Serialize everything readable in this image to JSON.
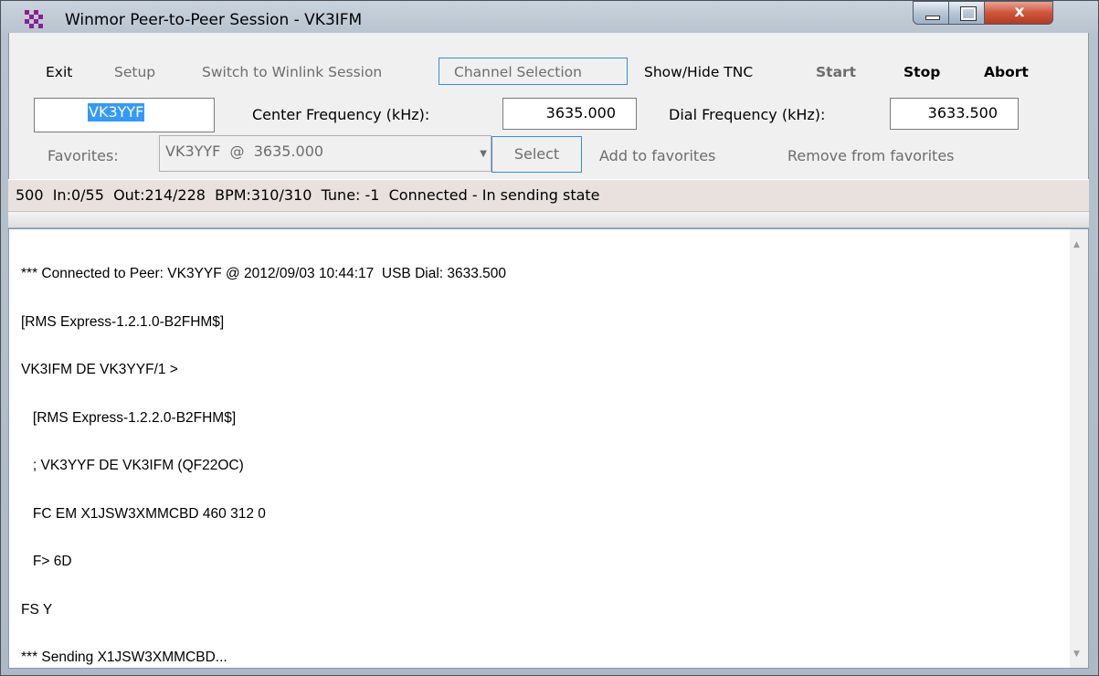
{
  "window": {
    "title": "Winmor Peer-to-Peer Session - VK3IFM",
    "close_glyph": "x"
  },
  "menu": [
    {
      "label": "Exit",
      "enabled": true,
      "bold": false
    },
    {
      "label": "Setup",
      "enabled": false,
      "bold": false
    },
    {
      "label": "Switch to Winlink Session",
      "enabled": false,
      "bold": false
    },
    {
      "label": "Channel Selection",
      "enabled": false,
      "bold": false
    },
    {
      "label": "Show/Hide TNC",
      "enabled": true,
      "bold": false
    },
    {
      "label": "Start",
      "enabled": false,
      "bold": true
    },
    {
      "label": "Stop",
      "enabled": true,
      "bold": true
    },
    {
      "label": "Abort",
      "enabled": true,
      "bold": true
    }
  ],
  "callsign": {
    "value": "VK3YYF"
  },
  "center_freq": {
    "label": "Center Frequency (kHz):",
    "value": "3635.000"
  },
  "dial_freq": {
    "label": "Dial Frequency (kHz):",
    "value": "3633.500"
  },
  "favorites": {
    "label": "Favorites:",
    "selected": "VK3YYF  @  3635.000",
    "select_label": "Select",
    "add_label": "Add to favorites",
    "remove_label": "Remove from favorites"
  },
  "status": {
    "text": "500  In:0/55  Out:214/228  BPM:310/310  Tune: -1  Connected - In sending state"
  },
  "log": {
    "lines": [
      "*** Connected to Peer: VK3YYF @ 2012/09/03 10:44:17  USB Dial: 3633.500",
      "[RMS Express-1.2.1.0-B2FHM$]",
      "VK3IFM DE VK3YYF/1 >",
      "   [RMS Express-1.2.2.0-B2FHM$]",
      "   ; VK3YYF DE VK3IFM (QF22OC)",
      "   FC EM X1JSW3XMMCBD 460 312 0",
      "   F> 6D",
      "FS Y",
      "*** Sending X1JSW3XMMCBD..."
    ]
  },
  "colors": {
    "selection": "#3399ff",
    "focus_border": "#3c8bd6",
    "status_bg": "#e8e1dd",
    "close_button": "#c94a32"
  }
}
